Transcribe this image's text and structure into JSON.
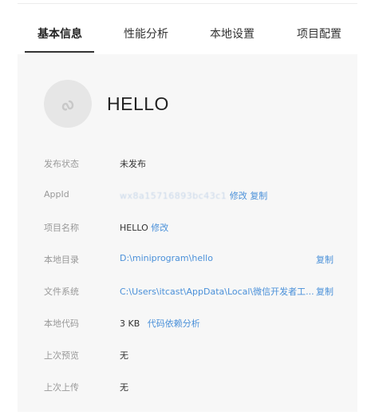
{
  "tabs": [
    {
      "label": "基本信息",
      "active": true
    },
    {
      "label": "性能分析",
      "active": false
    },
    {
      "label": "本地设置",
      "active": false
    },
    {
      "label": "项目配置",
      "active": false
    }
  ],
  "app": {
    "name": "HELLO",
    "avatar_icon": "miniprogram-logo-icon"
  },
  "rows": {
    "status": {
      "label": "发布状态",
      "value": "未发布"
    },
    "appid": {
      "label": "AppId",
      "value": "wx8a15716893bc43c1",
      "edit": "修改",
      "copy": "复制"
    },
    "project_name": {
      "label": "项目名称",
      "value": "HELLO",
      "edit": "修改"
    },
    "local_dir": {
      "label": "本地目录",
      "value": "D:\\miniprogram\\hello",
      "copy": "复制"
    },
    "filesystem": {
      "label": "文件系统",
      "value": "C:\\Users\\itcast\\AppData\\Local\\微信开发者工...",
      "copy": "复制"
    },
    "local_code": {
      "label": "本地代码",
      "value": "3 KB",
      "deps": "代码依赖分析"
    },
    "last_preview": {
      "label": "上次预览",
      "value": "无"
    },
    "last_upload": {
      "label": "上次上传",
      "value": "无"
    }
  },
  "colors": {
    "link": "#4a90d9",
    "label": "#999999",
    "panel_bg": "#f7f7f7"
  }
}
